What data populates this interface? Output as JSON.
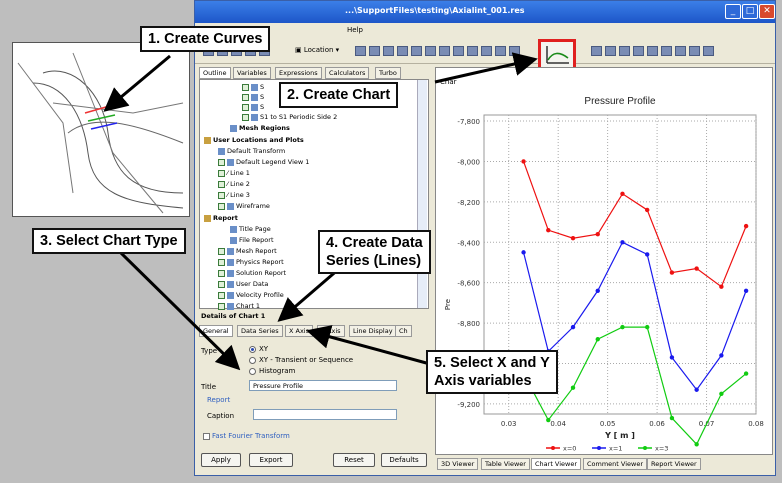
{
  "window": {
    "title": "...\\SupportFiles\\testing\\Axialint_001.res",
    "menu_help": "Help",
    "location_button": "Location",
    "min": "_",
    "max": "□",
    "close": "✕"
  },
  "top_tabs": [
    "Outline",
    "Variables",
    "Expressions",
    "Calculators",
    "Turbo"
  ],
  "tree": [
    {
      "label": "S",
      "indent": 3
    },
    {
      "label": "S",
      "indent": 3
    },
    {
      "label": "S",
      "indent": 3
    },
    {
      "label": "S1 to S1 Periodic Side 2",
      "indent": 3
    },
    {
      "label": "Mesh Regions",
      "indent": 2,
      "bold": true
    },
    {
      "label": "User Locations and Plots",
      "indent": 0,
      "bold": true
    },
    {
      "label": "Default Transform",
      "indent": 1
    },
    {
      "label": "Default Legend View 1",
      "indent": 1
    },
    {
      "label": "Line 1",
      "indent": 1
    },
    {
      "label": "Line 2",
      "indent": 1
    },
    {
      "label": "Line 3",
      "indent": 1
    },
    {
      "label": "Wireframe",
      "indent": 1
    },
    {
      "label": "Report",
      "indent": 0,
      "bold": true
    },
    {
      "label": "Title Page",
      "indent": 1
    },
    {
      "label": "File Report",
      "indent": 1
    },
    {
      "label": "Mesh Report",
      "indent": 1
    },
    {
      "label": "Physics Report",
      "indent": 1
    },
    {
      "label": "Solution Report",
      "indent": 1
    },
    {
      "label": "User Data",
      "indent": 1
    },
    {
      "label": "Velocity Profile",
      "indent": 1
    },
    {
      "label": "Chart 1",
      "indent": 1
    }
  ],
  "details": {
    "title": "Details of Chart 1",
    "tabs": [
      "General",
      "Data Series",
      "X Axis",
      "Y Axis",
      "Line Display",
      "Ch"
    ],
    "type_label": "Type",
    "type_options": [
      "XY",
      "XY - Transient or Sequence",
      "Histogram"
    ],
    "title_label": "Title",
    "title_value": "Pressure Profile",
    "report_label": "Report",
    "caption_label": "Caption",
    "caption_value": "",
    "fourier_label": "Fast Fourier Transform"
  },
  "buttons": {
    "apply": "Apply",
    "export": "Export",
    "reset": "Reset",
    "defaults": "Defaults"
  },
  "bottom_tabs": [
    "3D Viewer",
    "Table Viewer",
    "Chart Viewer",
    "Comment Viewer",
    "Report Viewer"
  ],
  "active_bottom_tab": "Chart Viewer",
  "chart_partial_header": "Char",
  "chart_data": {
    "type": "line",
    "title": "Pressure Profile",
    "xlabel": "Y [ m ]",
    "ylabel": "Pre",
    "xlim": [
      0.025,
      0.08
    ],
    "ylim": [
      -9250,
      -7770
    ],
    "xticks": [
      0.03,
      0.04,
      0.05,
      0.06,
      0.07,
      0.08
    ],
    "xtick_labels": [
      "0.03",
      "0.04",
      "0.05",
      "0.06",
      "0.07",
      "0.08"
    ],
    "yticks": [
      -7800,
      -8000,
      -8200,
      -8400,
      -8600,
      -8800,
      -9000,
      -9200
    ],
    "ytick_labels": [
      "-7,800",
      "-8,000",
      "-8,200",
      "-8,400",
      "-8,600",
      "-8,800",
      "-9,000",
      "-9,200"
    ],
    "grid": true,
    "legend": "bottom",
    "series": [
      {
        "name": "x=0",
        "color": "#ee1111",
        "x": [
          0.033,
          0.038,
          0.043,
          0.048,
          0.053,
          0.058,
          0.063,
          0.068,
          0.073,
          0.078
        ],
        "values": [
          -8000,
          -8340,
          -8380,
          -8360,
          -8160,
          -8240,
          -8550,
          -8530,
          -8620,
          -8320
        ]
      },
      {
        "name": "x=1",
        "color": "#1a1aee",
        "x": [
          0.033,
          0.038,
          0.043,
          0.048,
          0.053,
          0.058,
          0.063,
          0.068,
          0.073,
          0.078
        ],
        "values": [
          -8450,
          -8940,
          -8820,
          -8640,
          -8400,
          -8460,
          -8970,
          -9130,
          -8960,
          -8640
        ]
      },
      {
        "name": "x=3",
        "color": "#11cc11",
        "x": [
          0.033,
          0.038,
          0.043,
          0.048,
          0.053,
          0.058,
          0.063,
          0.068,
          0.073,
          0.078
        ],
        "values": [
          -9050,
          -9280,
          -9120,
          -8880,
          -8820,
          -8820,
          -9270,
          -9400,
          -9150,
          -9050
        ]
      }
    ]
  },
  "callouts": {
    "c1": "1. Create Curves",
    "c2": "2. Create Chart",
    "c3": "3. Select Chart Type",
    "c4a": "4. Create Data",
    "c4b": "Series (Lines)",
    "c5a": "5. Select X and Y",
    "c5b": "Axis variables"
  }
}
